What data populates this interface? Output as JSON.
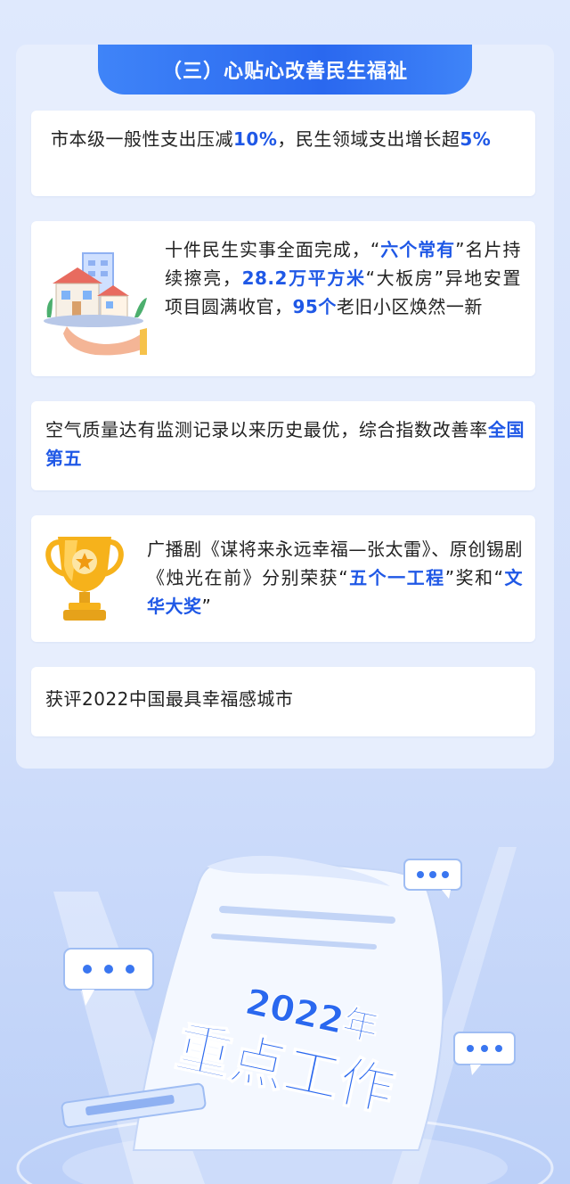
{
  "section": {
    "title": "（三）心贴心改善民生福祉"
  },
  "cards": [
    {
      "id": "fiscal",
      "segments": [
        "市本级一般性支出压减",
        "10%",
        "，民生领域支出增长超",
        "5%"
      ]
    },
    {
      "id": "livelihood",
      "icon": "house-on-hand-icon",
      "segments": [
        "十件民生实事全面完成，“",
        "六个常有",
        "”名片持续擦亮，",
        "28.2万平方米",
        "“大板房”异地安置项目圆满收官，",
        "95个",
        "老旧小区焕然一新"
      ]
    },
    {
      "id": "air",
      "segments": [
        "空气质量达有监测记录以来历史最优，综合指数改善率",
        "全国第五"
      ]
    },
    {
      "id": "awards",
      "icon": "trophy-icon",
      "segments": [
        "广播剧《谋将来永远幸福—张太雷》、原创锡剧《烛光在前》分别荣获“",
        "五个一工程",
        "”奖和“",
        "文华大奖",
        "”"
      ]
    },
    {
      "id": "happiness",
      "segments": [
        "获评2022中国最具幸福感城市"
      ]
    }
  ],
  "decoration": {
    "year": "2022年",
    "heading": "重点工作",
    "bubble_dots": "• • •"
  },
  "colors": {
    "accent": "#1f58e6",
    "banner": "#2a68ef",
    "trophy": "#f6b21b"
  }
}
